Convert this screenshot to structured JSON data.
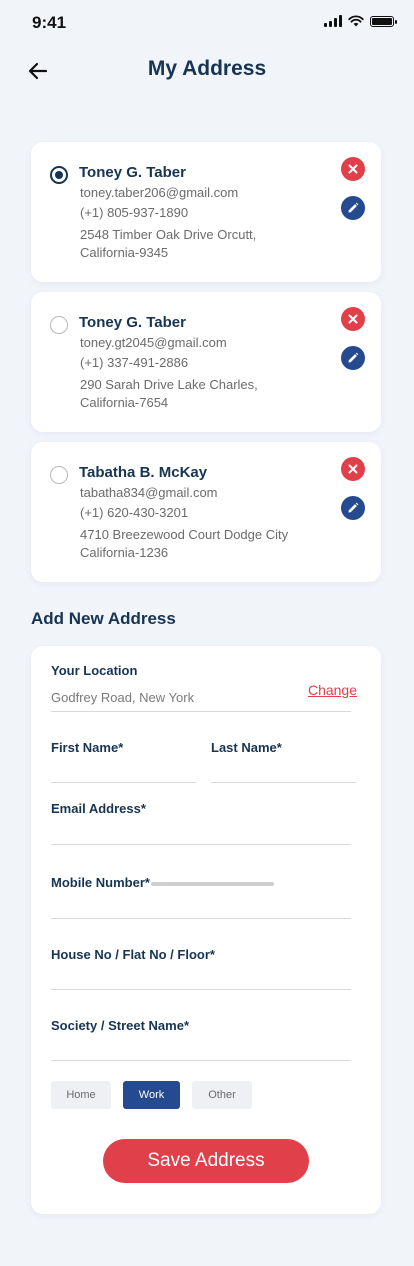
{
  "status_bar": {
    "time": "9:41"
  },
  "header": {
    "title": "My Address"
  },
  "addresses": [
    {
      "name": "Toney G. Taber",
      "email": "toney.taber206@gmail.com",
      "phone": "(+1) 805-937-1890",
      "address_line1": "2548 Timber Oak Drive Orcutt,",
      "address_line2": "California-9345",
      "selected": true
    },
    {
      "name": "Toney G. Taber",
      "email": "toney.gt2045@gmail.com",
      "phone": "(+1) 337-491-2886",
      "address_line1": "290 Sarah Drive Lake Charles,",
      "address_line2": "California-7654",
      "selected": false
    },
    {
      "name": "Tabatha B. McKay",
      "email": "tabatha834@gmail.com",
      "phone": "(+1) 620-430-3201",
      "address_line1": "4710 Breezewood Court Dodge City",
      "address_line2": "California-1236",
      "selected": false
    }
  ],
  "add_new": {
    "title": "Add New Address",
    "location_label": "Your Location",
    "location_value": "Godfrey Road, New York",
    "change_label": "Change",
    "first_name_label": "First Name*",
    "last_name_label": "Last Name*",
    "email_label": "Email Address*",
    "mobile_label": "Mobile Number*",
    "house_label": "House No / Flat No / Floor*",
    "street_label": "Society / Street Name*",
    "chips": [
      "Home",
      "Work",
      "Other"
    ],
    "selected_chip": "Work",
    "save_label": "Save Address"
  },
  "colors": {
    "accent_red": "#e0404a",
    "accent_blue": "#254a8f",
    "text_dark": "#173452",
    "background": "#f1f4f9"
  },
  "icons": {
    "back": "arrow-left-icon",
    "delete": "close-icon",
    "edit": "pencil-icon"
  }
}
